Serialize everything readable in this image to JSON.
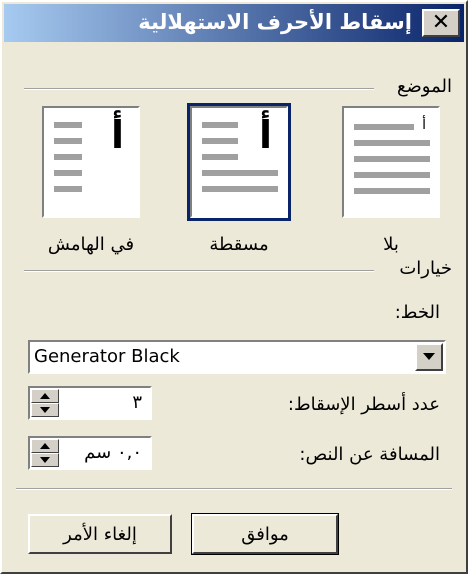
{
  "dialog": {
    "title": "إسقاط الأحرف الاستهلالية",
    "close_glyph": "✕"
  },
  "position": {
    "group_label": "الموضع",
    "options": [
      {
        "label": "بلا",
        "glyph": "أ",
        "selected": false
      },
      {
        "label": "مسقطة",
        "glyph": "أ",
        "selected": true
      },
      {
        "label": "في الهامش",
        "glyph": "أ",
        "selected": false
      }
    ]
  },
  "options": {
    "group_label": "خيارات",
    "font_label": "الخط:",
    "font_value": "Generator Black",
    "lines_label": "عدد أسطر الإسقاط:",
    "lines_value": "٣",
    "distance_label": "المسافة عن النص:",
    "distance_value": "٠,٠ سم"
  },
  "buttons": {
    "ok": "موافق",
    "cancel": "إلغاء الأمر"
  },
  "colors": {
    "title_start": "#a6caf0",
    "title_end": "#0a246a",
    "dialog_bg": "#ece9d8"
  }
}
